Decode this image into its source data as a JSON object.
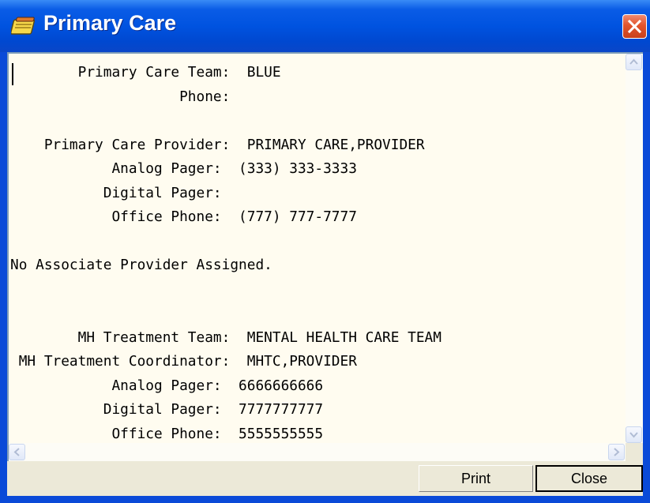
{
  "window": {
    "title": "Primary Care"
  },
  "content": {
    "text": "        Primary Care Team:  BLUE\n                    Phone:\n\n    Primary Care Provider:  PRIMARY CARE,PROVIDER\n            Analog Pager:  (333) 333-3333\n           Digital Pager:\n            Office Phone:  (777) 777-7777\n\nNo Associate Provider Assigned.\n\n\n        MH Treatment Team:  MENTAL HEALTH CARE TEAM\n MH Treatment Coordinator:  MHTC,PROVIDER\n            Analog Pager:  6666666666\n           Digital Pager:  7777777777\n            Office Phone:  5555555555"
  },
  "buttons": {
    "print": "Print",
    "close": "Close"
  },
  "icons": {
    "title": "notepad-icon",
    "close": "close-icon",
    "scroll_up": "arrow-up-icon",
    "scroll_down": "arrow-down-icon",
    "scroll_left": "arrow-left-icon",
    "scroll_right": "arrow-right-icon"
  },
  "colors": {
    "titlebar": "#0053e0",
    "memo_background": "#fffcf0",
    "close_button": "#e2542c",
    "dialog_face": "#ece9d8"
  }
}
